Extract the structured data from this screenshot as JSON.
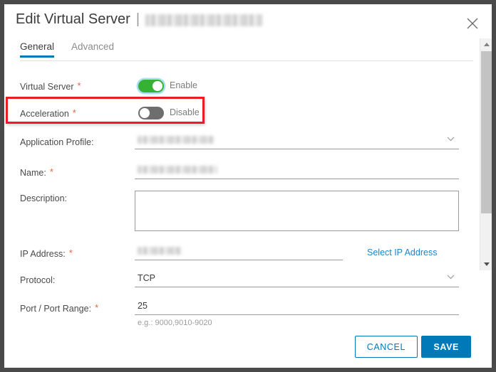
{
  "dialog": {
    "title_prefix": "Edit Virtual Server",
    "title_separator": "|",
    "title_redacted": "",
    "close_icon": "close-icon"
  },
  "tabs": [
    {
      "label": "General",
      "active": true
    },
    {
      "label": "Advanced",
      "active": false
    }
  ],
  "form": {
    "virtual_server": {
      "label": "Virtual Server",
      "required_marker": "*",
      "toggle_state": "on",
      "state_text": "Enable"
    },
    "acceleration": {
      "label": "Acceleration",
      "required_marker": "*",
      "toggle_state": "off",
      "state_text": "Disable",
      "highlighted": true
    },
    "application_profile": {
      "label": "Application Profile:",
      "value_redacted": "",
      "chevron": "chevron-down-icon"
    },
    "name": {
      "label": "Name:",
      "required_marker": "*",
      "value_redacted": ""
    },
    "description": {
      "label": "Description:",
      "value": "",
      "placeholder": ""
    },
    "ip_address": {
      "label": "IP Address:",
      "required_marker": "*",
      "value_redacted": "",
      "link_text": "Select IP Address"
    },
    "protocol": {
      "label": "Protocol:",
      "value": "TCP",
      "chevron": "chevron-down-icon"
    },
    "port_range": {
      "label": "Port / Port Range:",
      "required_marker": "*",
      "value": "25",
      "hint": "e.g.: 9000,9010-9020"
    }
  },
  "footer": {
    "cancel_label": "CANCEL",
    "save_label": "SAVE"
  },
  "colors": {
    "accent_blue": "#0079b8",
    "toggle_on_green": "#35b233",
    "toggle_off_gray": "#6e6e6e",
    "required_orange": "#e8633c",
    "annotation_red": "#ec1c24",
    "link_blue": "#1a86c8"
  }
}
